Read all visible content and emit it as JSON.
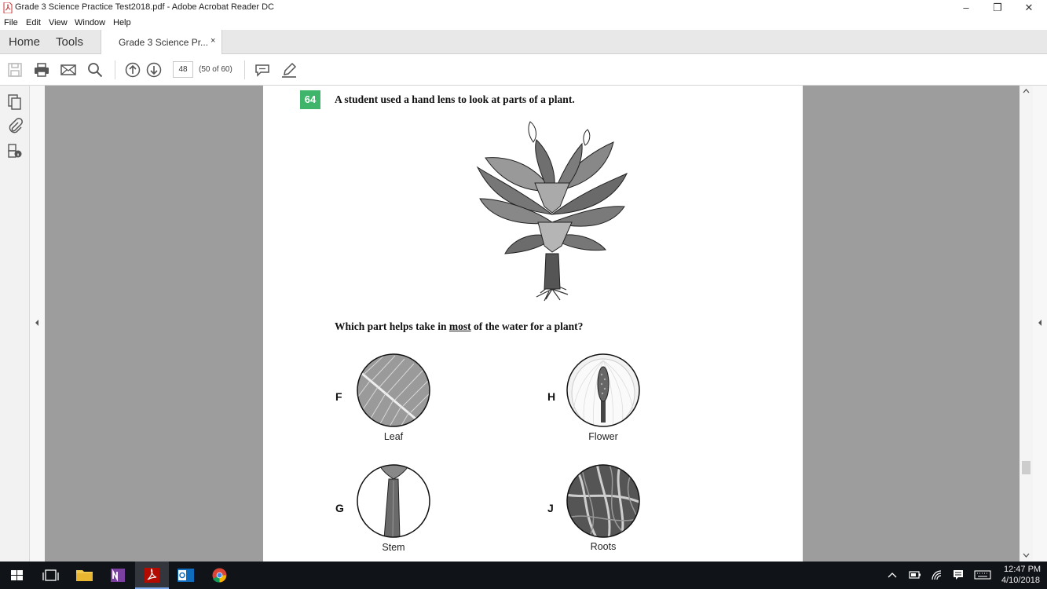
{
  "window": {
    "title": "Grade 3 Science Practice Test2018.pdf - Adobe Acrobat Reader DC"
  },
  "menu": [
    "File",
    "Edit",
    "View",
    "Window",
    "Help"
  ],
  "tabs": {
    "home": "Home",
    "tools": "Tools",
    "document": "Grade 3 Science Pr...",
    "close": "×"
  },
  "toolbar": {
    "page_number": "48",
    "page_count": "(50 of 60)"
  },
  "question": {
    "number": "64",
    "stem": "A student used a hand lens to look at parts of a plant.",
    "prompt_before": "Which part helps take in ",
    "prompt_emphasis": "most",
    "prompt_after": " of the water for a plant?",
    "options": [
      {
        "letter": "F",
        "caption": "Leaf"
      },
      {
        "letter": "H",
        "caption": "Flower"
      },
      {
        "letter": "G",
        "caption": "Stem"
      },
      {
        "letter": "J",
        "caption": "Roots"
      }
    ]
  },
  "taskbar": {
    "time": "12:47 PM",
    "date": "4/10/2018"
  },
  "colors": {
    "question_badge": "#3fb56b",
    "viewer_bg": "#9d9d9d",
    "taskbar_bg": "#101318"
  }
}
